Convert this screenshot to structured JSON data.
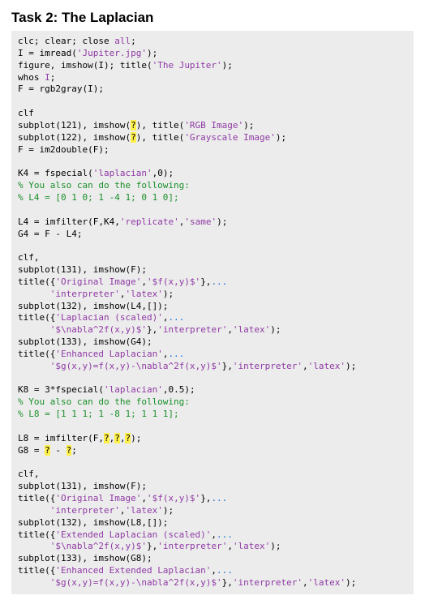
{
  "title": "Task 2: The Laplacian",
  "code": {
    "l01a": "clc",
    "l01b": "; ",
    "l01c": "clear",
    "l01d": "; ",
    "l01e": "close",
    "l01f": " ",
    "l01g": "all",
    "l01h": ";",
    "l02a": "I = imread(",
    "l02b": "'Jupiter.jpg'",
    "l02c": ");",
    "l03a": "figure, imshow(I); title(",
    "l03b": "'The Jupiter'",
    "l03c": ");",
    "l04a": "whos ",
    "l04b": "I",
    "l04c": ";",
    "l05a": "F = rgb2gray(I);",
    "l07a": "clf",
    "l08a": "subplot(121), imshow(",
    "l08b": "?",
    "l08c": "), title(",
    "l08d": "'RGB Image'",
    "l08e": ");",
    "l09a": "subplot(122), imshow(",
    "l09b": "?",
    "l09c": "), title(",
    "l09d": "'Grayscale Image'",
    "l09e": ");",
    "l10a": "F = im2double(F);",
    "l12a": "K4 = fspecial(",
    "l12b": "'laplacian'",
    "l12c": ",0);",
    "l13a": "% You also can do the following:",
    "l14a": "% L4 = [0 1 0; 1 -4 1; 0 1 0];",
    "l16a": "L4 = imfilter(F,K4,",
    "l16b": "'replicate'",
    "l16c": ",",
    "l16d": "'same'",
    "l16e": ");",
    "l17a": "G4 = F - L4;",
    "l19a": "clf,",
    "l20a": "subplot(131), imshow(F);",
    "l21a": "title({",
    "l21b": "'Original Image'",
    "l21c": ",",
    "l21d": "'$f(x,y)$'",
    "l21e": "},",
    "l21f": "...",
    "l22a": "      ",
    "l22b": "'interpreter'",
    "l22c": ",",
    "l22d": "'latex'",
    "l22e": ");",
    "l23a": "subplot(132), imshow(L4,[]);",
    "l24a": "title({",
    "l24b": "'Laplacian (scaled)'",
    "l24c": ",",
    "l24d": "...",
    "l25a": "      ",
    "l25b": "'$\\nabla^2f(x,y)$'",
    "l25c": "},",
    "l25d": "'interpreter'",
    "l25e": ",",
    "l25f": "'latex'",
    "l25g": ");",
    "l26a": "subplot(133), imshow(G4);",
    "l27a": "title({",
    "l27b": "'Enhanced Laplacian'",
    "l27c": ",",
    "l27d": "...",
    "l28a": "      ",
    "l28b": "'$g(x,y)=f(x,y)-\\nabla^2f(x,y)$'",
    "l28c": "},",
    "l28d": "'interpreter'",
    "l28e": ",",
    "l28f": "'latex'",
    "l28g": ");",
    "l30a": "K8 = 3*fspecial(",
    "l30b": "'laplacian'",
    "l30c": ",0.5);",
    "l31a": "% You also can do the following:",
    "l32a": "% L8 = [1 1 1; 1 -8 1; 1 1 1];",
    "l34a": "L8 = imfilter(F,",
    "l34b": "?",
    "l34c": ",",
    "l34d": "?",
    "l34e": ",",
    "l34f": "?",
    "l34g": ");",
    "l35a": "G8 = ",
    "l35b": "?",
    "l35c": " - ",
    "l35d": "?",
    "l35e": ";",
    "l37a": "clf,",
    "l38a": "subplot(131), imshow(F);",
    "l39a": "title({",
    "l39b": "'Original Image'",
    "l39c": ",",
    "l39d": "'$f(x,y)$'",
    "l39e": "},",
    "l39f": "...",
    "l40a": "      ",
    "l40b": "'interpreter'",
    "l40c": ",",
    "l40d": "'latex'",
    "l40e": ");",
    "l41a": "subplot(132), imshow(L8,[]);",
    "l42a": "title({",
    "l42b": "'Extended Laplacian (scaled)'",
    "l42c": ",",
    "l42d": "...",
    "l43a": "      ",
    "l43b": "'$\\nabla^2f(x,y)$'",
    "l43c": "},",
    "l43d": "'interpreter'",
    "l43e": ",",
    "l43f": "'latex'",
    "l43g": ");",
    "l44a": "subplot(133), imshow(G8);",
    "l45a": "title({",
    "l45b": "'Enhanced Extended Laplacian'",
    "l45c": ",",
    "l45d": "...",
    "l46a": "      ",
    "l46b": "'$g(x,y)=f(x,y)-\\nabla^2f(x,y)$'",
    "l46c": "},",
    "l46d": "'interpreter'",
    "l46e": ",",
    "l46f": "'latex'",
    "l46g": ");"
  }
}
